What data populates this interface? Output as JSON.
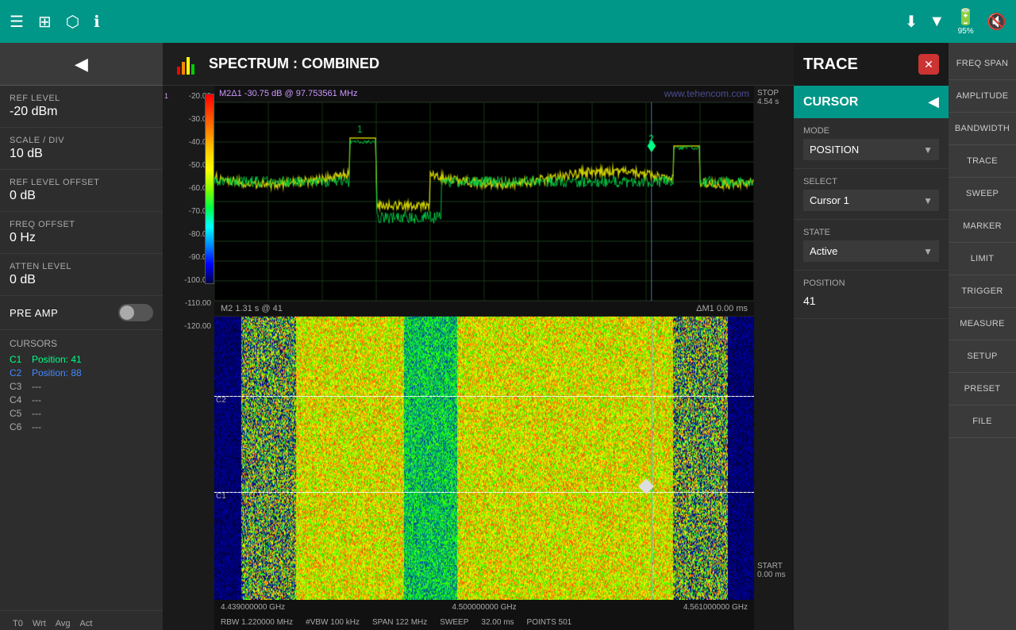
{
  "topbar": {
    "icons": [
      "menu-icon",
      "grid-icon",
      "camera-icon",
      "info-icon"
    ],
    "right_icons": [
      "download-icon",
      "wifi-icon",
      "battery-icon",
      "mute-icon"
    ],
    "battery_percent": "95%"
  },
  "left_sidebar": {
    "back_label": "◀",
    "settings": [
      {
        "label": "REF LEVEL",
        "value": "-20 dBm"
      },
      {
        "label": "SCALE / DIV",
        "value": "10 dB"
      },
      {
        "label": "REF LEVEL OFFSET",
        "value": "0 dB"
      },
      {
        "label": "FREQ OFFSET",
        "value": "0 Hz"
      },
      {
        "label": "ATTEN LEVEL",
        "value": "0 dB"
      }
    ],
    "pre_amp_label": "PRE AMP",
    "cursors_title": "CURSORS",
    "cursors": [
      {
        "name": "C1",
        "value": "Position: 41",
        "color": "#00ff88",
        "active": true
      },
      {
        "name": "C2",
        "value": "Position: 88",
        "color": "#4488ff",
        "active": true
      },
      {
        "name": "C3",
        "value": "---",
        "color": "#888888",
        "active": false
      },
      {
        "name": "C4",
        "value": "---",
        "color": "#888888",
        "active": false
      },
      {
        "name": "C5",
        "value": "---",
        "color": "#888888",
        "active": false
      },
      {
        "name": "C6",
        "value": "---",
        "color": "#888888",
        "active": false
      }
    ],
    "trace_tabs": [
      {
        "label": "T0",
        "active": false
      },
      {
        "label": "Wrt",
        "active": false
      },
      {
        "label": "Avg",
        "active": false
      },
      {
        "label": "Act",
        "active": false
      }
    ]
  },
  "spectrum": {
    "title": "SPECTRUM : COMBINED",
    "marker_info": "M2Δ1   -30.75 dB @ 97.753561 MHz",
    "website": "www.tehencom.com",
    "y_axis_labels": [
      "-20.00",
      "-30.00",
      "-40.00",
      "-50.00",
      "-60.00",
      "-70.00",
      "-80.00",
      "-90.00",
      "-100.00",
      "-110.00",
      "-120.00"
    ],
    "freq_labels": [
      "4.439000000 GHz",
      "4.500000000 GHz",
      "4.561000000 GHz"
    ],
    "rbw": "RBW 1.220000 MHz",
    "vbw": "#VBW 100 kHz",
    "span": "SPAN 122 MHz",
    "sweep_label": "SWEEP",
    "sweep_val": "32.00 ms",
    "points": "POINTS 501",
    "waterfall_m2": "M2 1.31 s @ 41",
    "waterfall_delta": "ΔM1  0.00 ms",
    "stop_label": "STOP",
    "stop_val": "4.54 s",
    "start_label": "START",
    "start_val": "0.00 ms",
    "c1_label": "C1",
    "c2_label": "C2"
  },
  "trace_panel": {
    "title": "TRACE",
    "close_icon": "✕",
    "cursor_title": "CURSOR",
    "back_arrow": "◀",
    "mode_label": "MODE",
    "mode_value": "POSITION",
    "select_label": "SELECT",
    "select_value": "Cursor 1",
    "state_label": "STATE",
    "state_value": "Active",
    "position_label": "POSITION",
    "position_value": "41"
  },
  "right_menu": {
    "items": [
      "FREQ SPAN",
      "AMPLITUDE",
      "BANDWIDTH",
      "TRACE",
      "SWEEP",
      "MARKER",
      "LIMIT",
      "TRIGGER",
      "MEASURE",
      "SETUP",
      "PRESET",
      "FILE"
    ]
  }
}
